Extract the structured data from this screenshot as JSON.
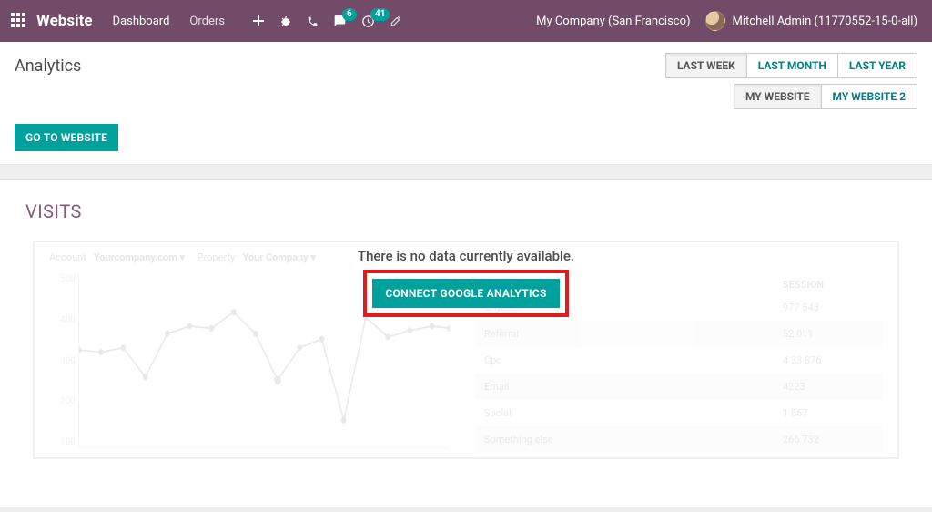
{
  "navbar": {
    "brand": "Website",
    "items": [
      {
        "label": "Dashboard"
      },
      {
        "label": "Orders"
      }
    ],
    "badge_conversations": "6",
    "badge_activities": "41",
    "company": "My Company (San Francisco)",
    "user": "Mitchell Admin (11770552-15-0-all)"
  },
  "page": {
    "title": "Analytics",
    "go_to_website": "GO TO WEBSITE"
  },
  "filters": {
    "period": [
      {
        "label": "LAST WEEK",
        "active": true
      },
      {
        "label": "LAST MONTH",
        "active": false
      },
      {
        "label": "LAST YEAR",
        "active": false
      }
    ],
    "website": [
      {
        "label": "MY WEBSITE",
        "active": true
      },
      {
        "label": "MY WEBSITE 2",
        "active": false
      }
    ]
  },
  "visits": {
    "title": "VISITS",
    "nodata": "There is no data currently available.",
    "connect": "CONNECT GOOGLE ANALYTICS",
    "placeholder": {
      "account_label": "Account",
      "account_value": "Yourcompany.com  ▾",
      "property_label": "Property",
      "property_value": "Your Company  ▾",
      "ylabels": [
        "500",
        "400",
        "300",
        "200",
        "100"
      ],
      "table_header": {
        "col1": "",
        "col2": "SESSION"
      },
      "rows": [
        {
          "label": "Organic",
          "value": "977 548"
        },
        {
          "label": "Referral",
          "value": "52 011"
        },
        {
          "label": "Cpc",
          "value": "4 33 876"
        },
        {
          "label": "Email",
          "value": "4223"
        },
        {
          "label": "Social",
          "value": "1 567"
        },
        {
          "label": "Something else",
          "value": "266 732"
        }
      ]
    }
  }
}
